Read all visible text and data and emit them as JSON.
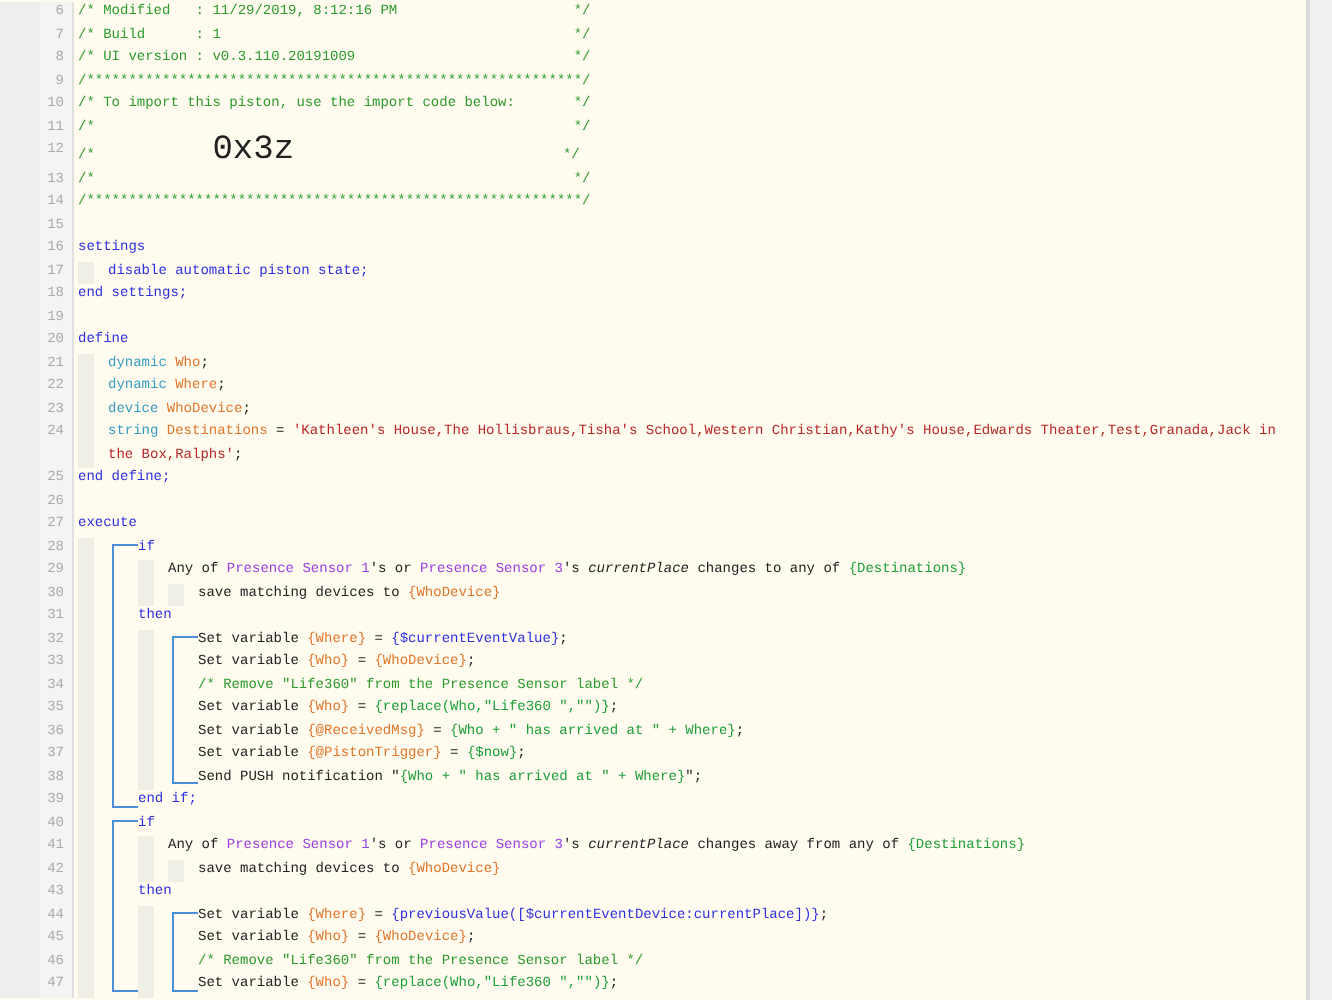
{
  "code": [
    {
      "number": "6",
      "tokens": [
        {
          "kind": "comment",
          "text": "/* Modified   : 11/29/2019, 8:12:16 PM                     */"
        }
      ]
    },
    {
      "number": "7",
      "tokens": [
        {
          "kind": "comment",
          "text": "/* Build      : 1                                          */"
        }
      ]
    },
    {
      "number": "8",
      "tokens": [
        {
          "kind": "comment",
          "text": "/* UI version : v0.3.110.20191009                          */"
        }
      ]
    },
    {
      "number": "9",
      "tokens": [
        {
          "kind": "comment",
          "text": "/***********************************************************/"
        }
      ]
    },
    {
      "number": "10",
      "tokens": [
        {
          "kind": "comment",
          "text": "/* To import this piston, use the import code below:       */"
        }
      ]
    },
    {
      "number": "11",
      "tokens": [
        {
          "kind": "comment",
          "text": "/*                                                         */"
        }
      ]
    },
    {
      "number": "12",
      "tokens": [
        {
          "kind": "comment",
          "text": "/*              "
        },
        {
          "kind": "code",
          "text": "0x3z"
        },
        {
          "kind": "comment",
          "text": "                                */"
        }
      ]
    },
    {
      "number": "13",
      "tokens": [
        {
          "kind": "comment",
          "text": "/*                                                         */"
        }
      ]
    },
    {
      "number": "14",
      "tokens": [
        {
          "kind": "comment",
          "text": "/***********************************************************/"
        }
      ]
    },
    {
      "number": "15"
    },
    {
      "number": "16",
      "tokens": [
        {
          "kind": "keyword",
          "text": "settings"
        }
      ],
      "children": [
        {
          "number": "17",
          "tokens": [
            {
              "kind": "keyword",
              "text": "disable automatic piston state;"
            }
          ]
        }
      ]
    },
    {
      "number": "18",
      "tokens": [
        {
          "kind": "keyword",
          "text": "end settings;"
        }
      ]
    },
    {
      "number": "19"
    },
    {
      "number": "20",
      "tokens": [
        {
          "kind": "keyword",
          "text": "define"
        }
      ],
      "children": [
        {
          "number": "21",
          "tokens": [
            {
              "kind": "type",
              "text": "dynamic "
            },
            {
              "kind": "var",
              "text": "Who"
            },
            {
              "kind": "plain",
              "text": ";"
            }
          ]
        },
        {
          "number": "22",
          "tokens": [
            {
              "kind": "type",
              "text": "dynamic "
            },
            {
              "kind": "var",
              "text": "Where"
            },
            {
              "kind": "plain",
              "text": ";"
            }
          ]
        },
        {
          "number": "23",
          "tokens": [
            {
              "kind": "type",
              "text": "device "
            },
            {
              "kind": "var",
              "text": "WhoDevice"
            },
            {
              "kind": "plain",
              "text": ";"
            }
          ]
        },
        {
          "number": "24",
          "tokens": [
            {
              "kind": "type",
              "text": "string "
            },
            {
              "kind": "var",
              "text": "Destinations"
            },
            {
              "kind": "plain",
              "text": " = "
            },
            {
              "kind": "string",
              "text": "'Kathleen's House,The Hollisbraus,Tisha's School,Western Christian,Kathy's House,Edwards Theater,Test,Granada,Jack in the Box,Ralphs'"
            },
            {
              "kind": "plain",
              "text": ";"
            }
          ]
        }
      ]
    },
    {
      "number": "25",
      "tokens": [
        {
          "kind": "keyword",
          "text": "end define;"
        }
      ]
    },
    {
      "number": "26"
    },
    {
      "number": "27",
      "tokens": [
        {
          "kind": "keyword",
          "text": "execute"
        }
      ],
      "children": [
        {
          "kind": "bracket",
          "children": [
            {
              "number": "28",
              "tokens": [
                {
                  "kind": "keyword",
                  "text": "if"
                }
              ],
              "children": [
                {
                  "number": "29",
                  "tokens": [
                    {
                      "kind": "plain",
                      "text": "Any of "
                    },
                    {
                      "kind": "device",
                      "text": "Presence Sensor 1"
                    },
                    {
                      "kind": "plain",
                      "text": "'s or "
                    },
                    {
                      "kind": "device",
                      "text": "Presence Sensor 3"
                    },
                    {
                      "kind": "plain",
                      "text": "'s "
                    },
                    {
                      "kind": "italic",
                      "text": "currentPlace"
                    },
                    {
                      "kind": "plain",
                      "text": " changes to any of "
                    },
                    {
                      "kind": "expr",
                      "text": "{Destinations}"
                    }
                  ],
                  "children": [
                    {
                      "number": "30",
                      "tokens": [
                        {
                          "kind": "plain",
                          "text": "save matching devices to "
                        },
                        {
                          "kind": "var",
                          "text": "{WhoDevice}"
                        }
                      ]
                    }
                  ]
                }
              ]
            },
            {
              "number": "31",
              "tokens": [
                {
                  "kind": "keyword",
                  "text": "then"
                }
              ],
              "children": [
                {
                  "kind": "bracket",
                  "children": [
                    {
                      "number": "32",
                      "tokens": [
                        {
                          "kind": "plain",
                          "text": "Set variable "
                        },
                        {
                          "kind": "var",
                          "text": "{Where}"
                        },
                        {
                          "kind": "plain",
                          "text": " = "
                        },
                        {
                          "kind": "func",
                          "text": "{$currentEventValue}"
                        },
                        {
                          "kind": "plain",
                          "text": ";"
                        }
                      ]
                    },
                    {
                      "number": "33",
                      "tokens": [
                        {
                          "kind": "plain",
                          "text": "Set variable "
                        },
                        {
                          "kind": "var",
                          "text": "{Who}"
                        },
                        {
                          "kind": "plain",
                          "text": " = "
                        },
                        {
                          "kind": "var",
                          "text": "{WhoDevice}"
                        },
                        {
                          "kind": "plain",
                          "text": ";"
                        }
                      ]
                    },
                    {
                      "number": "34",
                      "tokens": [
                        {
                          "kind": "comment",
                          "text": "/* Remove \"Life360\" from the Presence Sensor label */"
                        }
                      ]
                    },
                    {
                      "number": "35",
                      "tokens": [
                        {
                          "kind": "plain",
                          "text": "Set variable "
                        },
                        {
                          "kind": "var",
                          "text": "{Who}"
                        },
                        {
                          "kind": "plain",
                          "text": " = "
                        },
                        {
                          "kind": "expr",
                          "text": "{replace(Who,\"Life360 \",\"\")}"
                        },
                        {
                          "kind": "plain",
                          "text": ";"
                        }
                      ]
                    },
                    {
                      "number": "36",
                      "tokens": [
                        {
                          "kind": "plain",
                          "text": "Set variable "
                        },
                        {
                          "kind": "var",
                          "text": "{@ReceivedMsg}"
                        },
                        {
                          "kind": "plain",
                          "text": " = "
                        },
                        {
                          "kind": "expr",
                          "text": "{Who + \" has arrived at \" + Where}"
                        },
                        {
                          "kind": "plain",
                          "text": ";"
                        }
                      ]
                    },
                    {
                      "number": "37",
                      "tokens": [
                        {
                          "kind": "plain",
                          "text": "Set variable "
                        },
                        {
                          "kind": "var",
                          "text": "{@PistonTrigger}"
                        },
                        {
                          "kind": "plain",
                          "text": " = "
                        },
                        {
                          "kind": "expr",
                          "text": "{$now}"
                        },
                        {
                          "kind": "plain",
                          "text": ";"
                        }
                      ]
                    },
                    {
                      "number": "38",
                      "tokens": [
                        {
                          "kind": "plain",
                          "text": "Send PUSH notification \""
                        },
                        {
                          "kind": "expr",
                          "text": "{Who + \" has arrived at \" + Where}"
                        },
                        {
                          "kind": "plain",
                          "text": "\";"
                        }
                      ]
                    }
                  ]
                }
              ]
            },
            {
              "number": "39",
              "tokens": [
                {
                  "kind": "keyword",
                  "text": "end if;"
                }
              ]
            }
          ]
        },
        {
          "kind": "bracket",
          "children": [
            {
              "number": "40",
              "tokens": [
                {
                  "kind": "keyword",
                  "text": "if"
                }
              ],
              "children": [
                {
                  "number": "41",
                  "tokens": [
                    {
                      "kind": "plain",
                      "text": "Any of "
                    },
                    {
                      "kind": "device",
                      "text": "Presence Sensor 1"
                    },
                    {
                      "kind": "plain",
                      "text": "'s or "
                    },
                    {
                      "kind": "device",
                      "text": "Presence Sensor 3"
                    },
                    {
                      "kind": "plain",
                      "text": "'s "
                    },
                    {
                      "kind": "italic",
                      "text": "currentPlace"
                    },
                    {
                      "kind": "plain",
                      "text": " changes away from any of "
                    },
                    {
                      "kind": "expr",
                      "text": "{Destinations}"
                    }
                  ],
                  "children": [
                    {
                      "number": "42",
                      "tokens": [
                        {
                          "kind": "plain",
                          "text": "save matching devices to "
                        },
                        {
                          "kind": "var",
                          "text": "{WhoDevice}"
                        }
                      ]
                    }
                  ]
                }
              ]
            },
            {
              "number": "43",
              "tokens": [
                {
                  "kind": "keyword",
                  "text": "then"
                }
              ],
              "children": [
                {
                  "kind": "bracket",
                  "children": [
                    {
                      "number": "44",
                      "tokens": [
                        {
                          "kind": "plain",
                          "text": "Set variable "
                        },
                        {
                          "kind": "var",
                          "text": "{Where}"
                        },
                        {
                          "kind": "plain",
                          "text": " = "
                        },
                        {
                          "kind": "func",
                          "text": "{previousValue([$currentEventDevice:currentPlace])}"
                        },
                        {
                          "kind": "plain",
                          "text": ";"
                        }
                      ]
                    },
                    {
                      "number": "45",
                      "tokens": [
                        {
                          "kind": "plain",
                          "text": "Set variable "
                        },
                        {
                          "kind": "var",
                          "text": "{Who}"
                        },
                        {
                          "kind": "plain",
                          "text": " = "
                        },
                        {
                          "kind": "var",
                          "text": "{WhoDevice}"
                        },
                        {
                          "kind": "plain",
                          "text": ";"
                        }
                      ]
                    },
                    {
                      "number": "46",
                      "tokens": [
                        {
                          "kind": "comment",
                          "text": "/* Remove \"Life360\" from the Presence Sensor label */"
                        }
                      ]
                    },
                    {
                      "number": "47",
                      "tokens": [
                        {
                          "kind": "plain",
                          "text": "Set variable "
                        },
                        {
                          "kind": "var",
                          "text": "{Who}"
                        },
                        {
                          "kind": "plain",
                          "text": " = "
                        },
                        {
                          "kind": "expr",
                          "text": "{replace(Who,\"Life360 \",\"\")}"
                        },
                        {
                          "kind": "plain",
                          "text": ";"
                        }
                      ]
                    }
                  ]
                }
              ]
            }
          ]
        }
      ]
    }
  ]
}
